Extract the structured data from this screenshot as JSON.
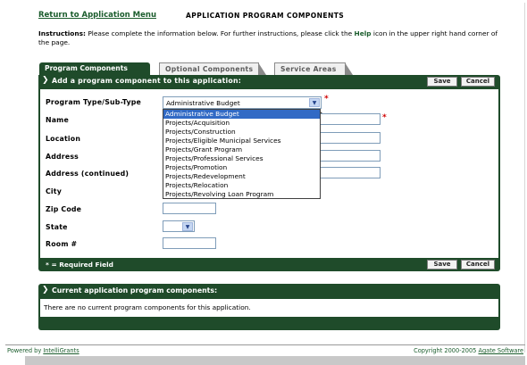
{
  "header": {
    "return_link": "Return to Application Menu",
    "title": "APPLICATION PROGRAM COMPONENTS"
  },
  "instructions": {
    "label": "Instructions:",
    "text_before": " Please complete the information below. For further instructions, please click the ",
    "help": "Help",
    "text_after": " icon in the upper right hand corner of the page."
  },
  "tabs": [
    {
      "label": "Program Components",
      "active": true
    },
    {
      "label": "Optional Components",
      "active": false
    },
    {
      "label": "Service Areas",
      "active": false
    }
  ],
  "panel": {
    "heading": "Add a program component to this application:",
    "save_label": "Save",
    "cancel_label": "Cancel",
    "required_note": "* = Required Field"
  },
  "form": {
    "program_type_label": "Program Type/Sub-Type",
    "program_type_value": "Administrative Budget",
    "name_label": "Name",
    "location_label": "Location",
    "address_label": "Address",
    "address2_label": "Address (continued)",
    "city_label": "City",
    "zip_label": "Zip Code",
    "state_label": "State",
    "room_label": "Room #",
    "required_marker": "*"
  },
  "dropdown_options": [
    "Administrative Budget",
    "Projects/Acquisition",
    "Projects/Construction",
    "Projects/Eligible Municipal Services",
    "Projects/Grant Program",
    "Projects/Professional Services",
    "Projects/Promotion",
    "Projects/Redevelopment",
    "Projects/Relocation",
    "Projects/Revolving Loan Program"
  ],
  "current": {
    "heading": "Current application program components:",
    "empty_text": "There are no current program components for this application."
  },
  "footer": {
    "powered_prefix": "Powered by ",
    "powered_link": "IntelliGrants",
    "copyright_prefix": "Copyright 2000-2005 ",
    "copyright_link": "Agate Software"
  },
  "colors": {
    "panel_green": "#1f4b2a",
    "link_green": "#1a5c2c",
    "required_red": "#d10000",
    "selection_blue": "#316ac5"
  }
}
